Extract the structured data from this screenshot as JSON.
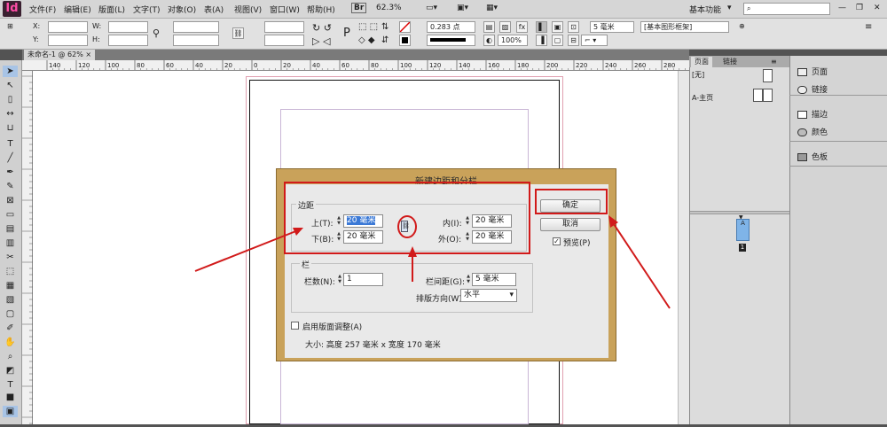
{
  "app": {
    "logo": "Id",
    "workspace": "基本功能",
    "search_icon": "search-icon"
  },
  "menu": [
    "文件(F)",
    "编辑(E)",
    "版面(L)",
    "文字(T)",
    "对象(O)",
    "表(A)",
    "视图(V)",
    "窗口(W)",
    "帮助(H)"
  ],
  "menu_extra": {
    "br": "Br",
    "zoom": "62.3%"
  },
  "control": {
    "x_label": "X:",
    "y_label": "Y:",
    "w_label": "W:",
    "h_label": "H:",
    "stroke_weight": "0.283 点",
    "scale": "100%",
    "offset": "5 毫米",
    "frame_style": "[基本图形框架]"
  },
  "doc_tab": {
    "name": "未命名-1 @ 62%",
    "close": "×"
  },
  "ruler_h": [
    "140",
    "120",
    "100",
    "80",
    "60",
    "40",
    "20",
    "0",
    "20",
    "40",
    "60",
    "80",
    "100",
    "120",
    "140",
    "160",
    "180",
    "200",
    "220",
    "240",
    "260",
    "280",
    "300"
  ],
  "pages_panel": {
    "tabs": [
      "页面",
      "链接"
    ],
    "items": [
      "[无]",
      "A-主页"
    ],
    "page_letter": "A",
    "page_number": "1"
  },
  "right_panel": {
    "items": [
      {
        "label": "页面",
        "icon": "pages-icon"
      },
      {
        "label": "链接",
        "icon": "links-icon"
      },
      {
        "label": "描边",
        "icon": "stroke-icon"
      },
      {
        "label": "颜色",
        "icon": "color-icon"
      },
      {
        "label": "色板",
        "icon": "swatches-icon"
      }
    ]
  },
  "dialog": {
    "title": "新建边距和分栏",
    "margins_group": "边距",
    "top_label": "上(T):",
    "top_value": "20 毫米",
    "bottom_label": "下(B):",
    "bottom_value": "20 毫米",
    "inside_label": "内(I):",
    "inside_value": "20 毫米",
    "outside_label": "外(O):",
    "outside_value": "20 毫米",
    "columns_group": "栏",
    "columns_label": "栏数(N):",
    "columns_value": "1",
    "gutter_label": "栏间距(G):",
    "gutter_value": "5 毫米",
    "direction_label": "排版方向(W):",
    "direction_value": "水平",
    "layout_adjust_label": "启用版面调整(A)",
    "size_text": "大小: 高度 257 毫米 x 宽度 170 毫米",
    "ok_label": "确定",
    "cancel_label": "取消",
    "preview_label": "预览(P)",
    "preview_checked": "✓"
  },
  "annotation_colors": {
    "highlight": "#d11a1a"
  }
}
